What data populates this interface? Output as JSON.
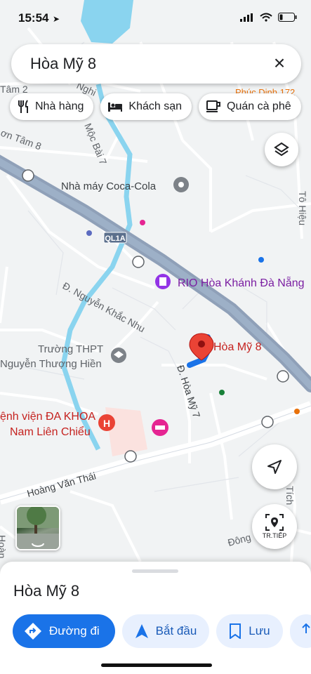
{
  "status_bar": {
    "time": "15:54"
  },
  "search": {
    "query": "Hòa Mỹ 8"
  },
  "chips": [
    {
      "label": "Nhà hàng",
      "icon": "restaurant-icon"
    },
    {
      "label": "Khách sạn",
      "icon": "hotel-icon"
    },
    {
      "label": "Quán cà phê",
      "icon": "coffee-icon"
    }
  ],
  "map": {
    "labels": {
      "tam2": "Tâm 2",
      "tam8": "ơn Tâm 8",
      "nghi": "Nghi",
      "moc_bai": "Mộc Bài 7",
      "phuc_dinh": "Phúc Dinh 172",
      "coca": "Nhà máy Coca-Cola",
      "to_hieu": "Tô Hiệu",
      "ql1a": "QL1A",
      "rio": "RIO Hòa Khánh Đà Nẵng",
      "nguyen_khac_nhu": "Đ. Nguyễn Khắc Nhu",
      "hoa_my_8": "Hòa Mỹ 8",
      "truong_1": "Trường THPT",
      "truong_2": "Nguyễn Thượng Hiền",
      "hoa_my_7": "Đ. Hòa Mỹ 7",
      "benhvien_1": "ệnh viện ĐA KHOA",
      "benhvien_2": "Nam Liên Chiểu",
      "hoang_van_thai": "Hoàng Văn Thái",
      "dong": "Đông",
      "tich": "Tích",
      "hoan": "Hoàn"
    },
    "colors": {
      "road_main": "#8fa0b8",
      "river": "#8ad4ef",
      "route": "#1a73e8",
      "pin": "#ea4335",
      "poi_purple": "#9334e6",
      "hospital": "#ea4335"
    }
  },
  "controls": {
    "live_view_label": "TR.TIẾP"
  },
  "place": {
    "name": "Hòa Mỹ 8"
  },
  "actions": {
    "directions": "Đường đi",
    "start": "Bắt đầu",
    "save": "Lưu"
  }
}
